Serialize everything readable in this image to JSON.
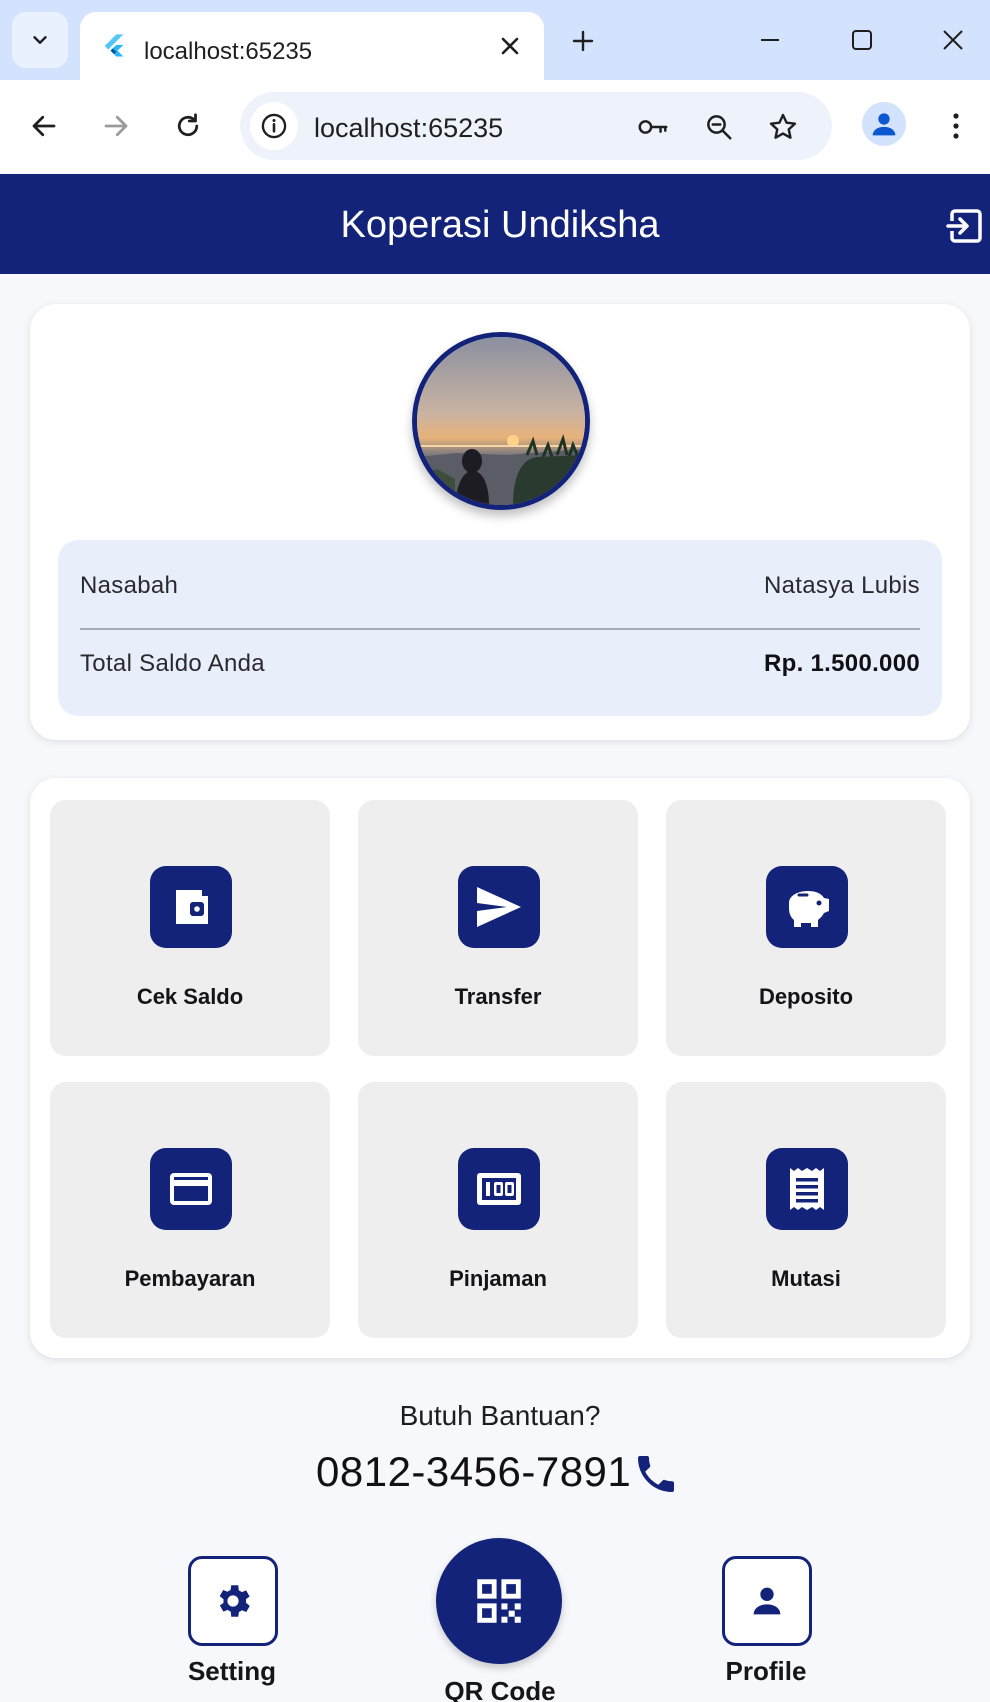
{
  "browser": {
    "tab_title": "localhost:65235",
    "address": "localhost:65235"
  },
  "app": {
    "title": "Koperasi Undiksha"
  },
  "account": {
    "nasabah_label": "Nasabah",
    "nasabah_value": "Natasya Lubis",
    "saldo_label": "Total Saldo Anda",
    "saldo_value": "Rp. 1.500.000"
  },
  "menu": {
    "items": [
      {
        "label": "Cek Saldo",
        "icon": "wallet-icon"
      },
      {
        "label": "Transfer",
        "icon": "send-icon"
      },
      {
        "label": "Deposito",
        "icon": "piggy-bank-icon"
      },
      {
        "label": "Pembayaran",
        "icon": "credit-card-icon"
      },
      {
        "label": "Pinjaman",
        "icon": "money-icon"
      },
      {
        "label": "Mutasi",
        "icon": "receipt-icon"
      }
    ]
  },
  "help": {
    "title": "Butuh Bantuan?",
    "phone": "0812-3456-7891"
  },
  "bottom_nav": {
    "setting": "Setting",
    "qr": "QR Code",
    "profile": "Profile"
  },
  "colors": {
    "primary": "#13237a",
    "info_box": "#e8effb",
    "tile": "#eeeeee"
  }
}
